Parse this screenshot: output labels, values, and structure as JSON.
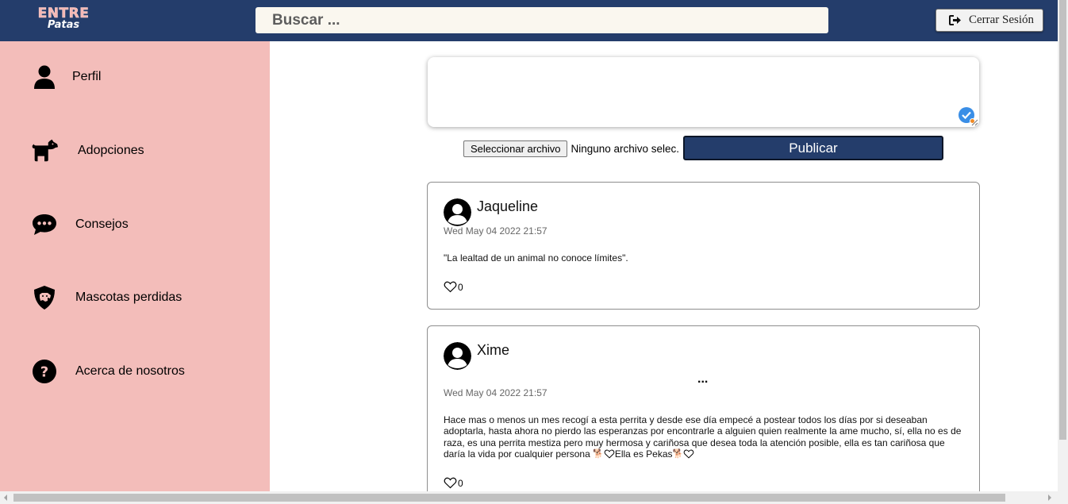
{
  "header": {
    "logo_line1": "ENTRE",
    "logo_line2": "Patas",
    "search_placeholder": "Buscar ...",
    "logout_label": "Cerrar Sesión",
    "logout_icon": "sign-out-icon",
    "bar_color": "#243d6b"
  },
  "sidebar": {
    "background": "#f3bdba",
    "items": [
      {
        "label": "Perfil",
        "icon": "user-icon"
      },
      {
        "label": "Adopciones",
        "icon": "dog-icon"
      },
      {
        "label": "Consejos",
        "icon": "chat-bubble-icon"
      },
      {
        "label": "Mascotas perdidas",
        "icon": "shield-dog-icon"
      },
      {
        "label": "Acerca de nosotros",
        "icon": "question-circle-icon"
      }
    ]
  },
  "composer": {
    "text": "",
    "file_button_label": "Seleccionar archivo",
    "file_status": "Ninguno archivo selec.",
    "publish_label": "Publicar"
  },
  "posts": [
    {
      "author": "Jaqueline",
      "date": "Wed May 04 2022 21:57",
      "body": "\"La lealtad de un animal no conoce límites\".",
      "likes": "0"
    },
    {
      "author": "Xime",
      "more": "...",
      "date": "Wed May 04 2022 21:57",
      "body_line1": "Hace mas o menos un mes recogí a esta perrita y desde ese día empecé a postear todos los días por si deseaban",
      "body_line2": "adoptarla, hasta ahora no pierdo las esperanzas por encontrarle a alguien quien realmente la ame mucho, sí, ella no es de",
      "body_line3": "raza, es una perrita mestiza pero muy hermosa y cariñosa que desea toda la atención posible, ella es tan cariñosa que",
      "body_line4_a": "daría la vida por cualquier persona ",
      "body_line4_b": "Ella es Pekas",
      "emoji": "🐕",
      "likes": "0"
    }
  ]
}
